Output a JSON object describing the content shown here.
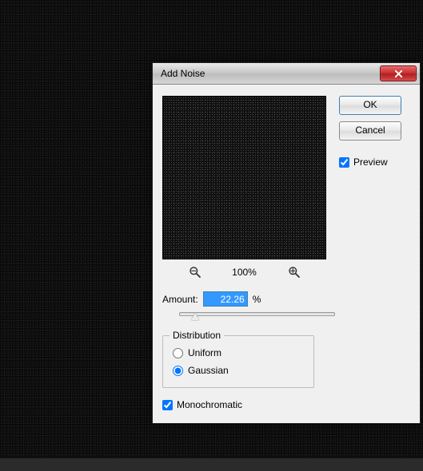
{
  "dialog": {
    "title": "Add Noise",
    "close_icon": "close-icon"
  },
  "buttons": {
    "ok": "OK",
    "cancel": "Cancel"
  },
  "preview_check": {
    "label": "Preview",
    "checked": true
  },
  "zoom": {
    "label": "100%"
  },
  "amount": {
    "label": "Amount:",
    "value": "22.26",
    "unit": "%",
    "slider_percent": 8
  },
  "distribution": {
    "legend": "Distribution",
    "options": {
      "uniform": "Uniform",
      "gaussian": "Gaussian"
    },
    "selected": "gaussian"
  },
  "monochromatic": {
    "label": "Monochromatic",
    "checked": true
  }
}
